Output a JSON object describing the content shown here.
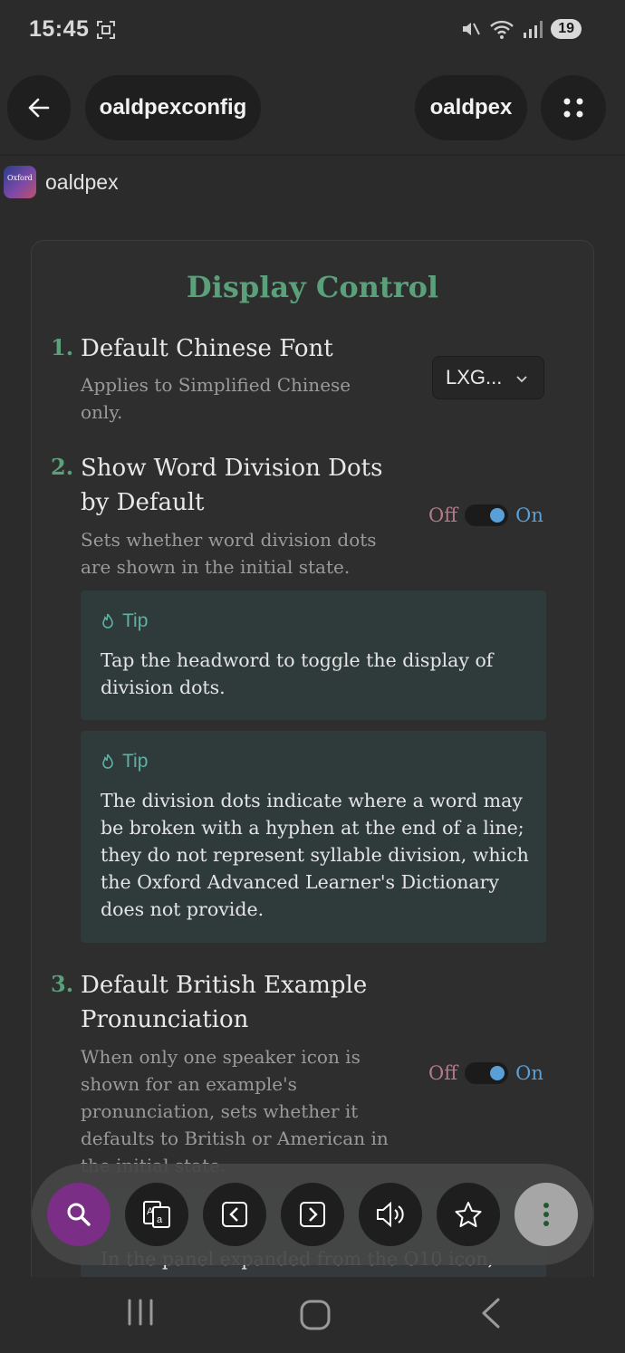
{
  "status_bar": {
    "time": "15:45",
    "battery": "19",
    "icons": [
      "screenshot-icon",
      "mute-icon",
      "wifi-icon",
      "signal-icon",
      "battery-icon"
    ]
  },
  "top_nav": {
    "back_icon": "back-arrow-icon",
    "config_label": "oaldpexconfig",
    "app_label": "oaldpex",
    "grid_icon": "grid-icon"
  },
  "app_line": {
    "icon_text": "Oxford",
    "name": "oaldpex"
  },
  "card": {
    "title": "Display Control",
    "items": [
      {
        "number": "1.",
        "title": "Default Chinese Font",
        "description": "Applies to Simplified Chinese only.",
        "control": {
          "type": "select",
          "value": "LXG..."
        }
      },
      {
        "number": "2.",
        "title": "Show Word Division Dots by Default",
        "description": "Sets whether word division dots are shown in the initial state.",
        "control": {
          "type": "toggle",
          "off_label": "Off",
          "on_label": "On",
          "state": "on"
        },
        "tips": [
          {
            "label": "Tip",
            "text": "Tap the headword to toggle the display of division dots."
          },
          {
            "label": "Tip",
            "text": "The division dots indicate where a word may be broken with a hyphen at the end of a line; they do not represent syllable division, which the Oxford Advanced Learner's Dictionary does not provide."
          }
        ]
      },
      {
        "number": "3.",
        "title": "Default British Example Pronunciation",
        "description": "When only one speaker icon is shown for an example's pronunciation, sets whether it defaults to British or American in the initial state.",
        "control": {
          "type": "toggle",
          "off_label": "Off",
          "on_label": "On",
          "state": "on"
        },
        "tips": [
          {
            "label": "",
            "text": "In the panel expanded from the O10 icon,"
          }
        ]
      }
    ]
  },
  "toolbar": {
    "buttons": [
      "search-icon",
      "translate-icon",
      "previous-icon",
      "next-icon",
      "speaker-icon",
      "star-icon",
      "more-icon"
    ]
  },
  "nav_bar": {
    "buttons": [
      "recent-apps-icon",
      "home-icon",
      "back-icon"
    ]
  },
  "colors": {
    "accent_green": "#5aa07a",
    "toggle_blue": "#5aa0d8",
    "off_pink": "#b57a8a",
    "tip_bg": "#2e3b3a",
    "search_purple": "#7a2e86"
  }
}
